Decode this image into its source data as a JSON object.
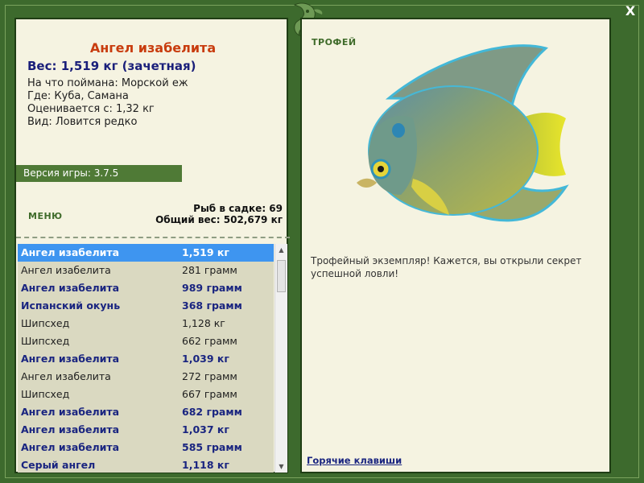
{
  "fish": {
    "name": "Ангел изабелита",
    "weight_line": "Вес: 1,519 кг (зачетная)",
    "caught_on": "На что поймана: Морской еж",
    "where": "Где: Куба, Самана",
    "rated_from": "Оценивается с: 1,32 кг",
    "species": "Вид: Ловится редко"
  },
  "version": "Версия игры: 3.7.5",
  "menu_label": "МЕНЮ",
  "stats": {
    "fish_in_cage": "Рыб в садке: 69",
    "total_weight": "Общий вес: 502,679 кг"
  },
  "catch_list": [
    {
      "name": "Ангел изабелита",
      "weight": "1,519 кг",
      "style": "selected"
    },
    {
      "name": "Ангел изабелита",
      "weight": "281 грамм",
      "style": "normal"
    },
    {
      "name": "Ангел изабелита",
      "weight": "989 грамм",
      "style": "trophy"
    },
    {
      "name": "Испанский окунь",
      "weight": "368 грамм",
      "style": "trophy"
    },
    {
      "name": "Шипсхед",
      "weight": "1,128 кг",
      "style": "normal"
    },
    {
      "name": "Шипсхед",
      "weight": "662 грамм",
      "style": "normal"
    },
    {
      "name": "Ангел изабелита",
      "weight": "1,039 кг",
      "style": "trophy"
    },
    {
      "name": "Ангел изабелита",
      "weight": "272 грамм",
      "style": "normal"
    },
    {
      "name": "Шипсхед",
      "weight": "667 грамм",
      "style": "normal"
    },
    {
      "name": "Ангел изабелита",
      "weight": "682 грамм",
      "style": "trophy"
    },
    {
      "name": "Ангел изабелита",
      "weight": "1,037 кг",
      "style": "trophy"
    },
    {
      "name": "Ангел изабелита",
      "weight": "585 грамм",
      "style": "trophy"
    },
    {
      "name": "Серый ангел",
      "weight": "1,118 кг",
      "style": "trophy"
    }
  ],
  "trophy": {
    "label": "ТРОФЕЙ",
    "message": "Трофейный экземпляр! Кажется, вы открыли секрет успешной ловли!"
  },
  "hotkeys_label": "Горячие клавиши",
  "close_label": "X",
  "colors": {
    "frame": "#3d6a2d",
    "panel": "#f5f3e1",
    "selected_row": "#3e95f0",
    "trophy_text": "#1a2580",
    "title": "#c83c0e"
  }
}
